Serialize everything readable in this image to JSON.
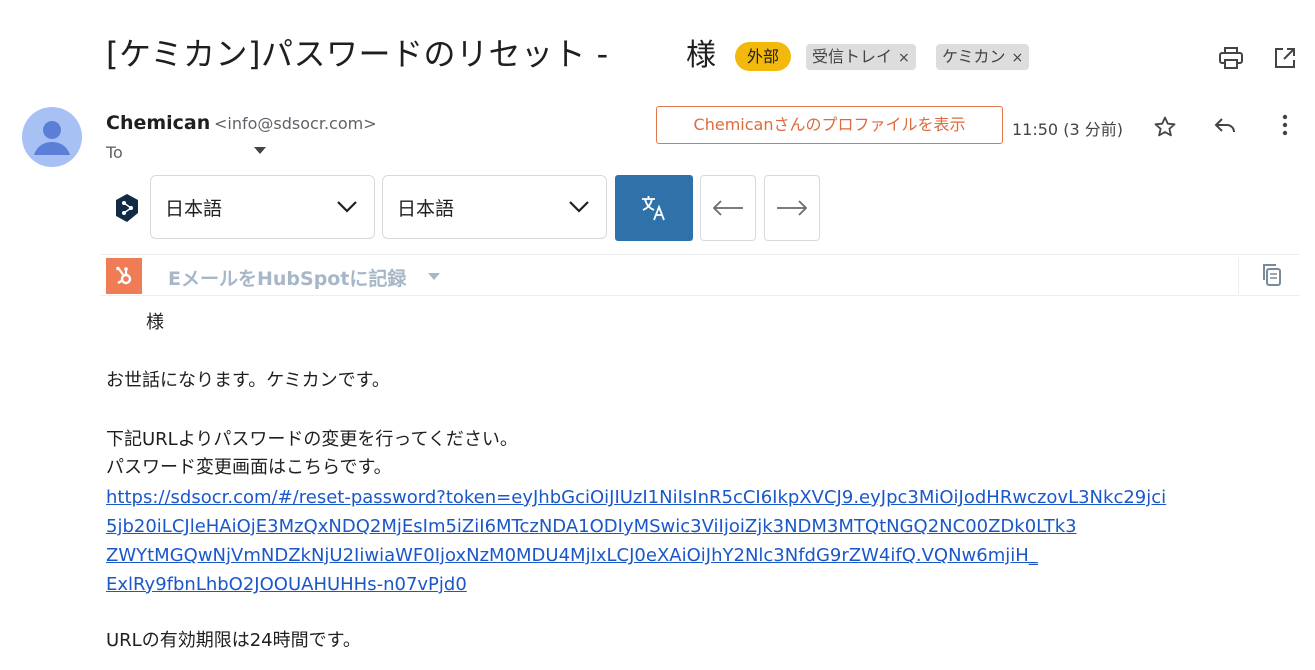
{
  "header": {
    "subject": "[ケミカン]パスワードのリセット -",
    "recipient_suffix": "様",
    "external_badge": "外部",
    "labels": [
      {
        "label": "受信トレイ",
        "close": "×"
      },
      {
        "label": "ケミカン",
        "close": "×"
      }
    ],
    "icons": [
      "print-icon",
      "open-in-new-window-icon"
    ]
  },
  "sender": {
    "name": "Chemican",
    "email": "<info@sdsocr.com>",
    "to_label": "To",
    "profile_button": "Chemicanさんのプロファイルを表示",
    "time": "11:50 (3 分前)"
  },
  "translate": {
    "source_language": "日本語",
    "target_language": "日本語",
    "translate_icon": "translate-icon",
    "back_arrow": "←",
    "forward_arrow": "→"
  },
  "hubspot": {
    "label": "EメールをHubSpotに記録"
  },
  "body": {
    "greeting": "様",
    "intro": "お世話になります。ケミカンです。",
    "instruction": "下記URLよりパスワードの変更を行ってください。",
    "page_note": "パスワード変更画面はこちらです。",
    "link_lines": [
      "https://sdsocr.com/#/reset-password?token=eyJhbGciOiJIUzI1NiIsInR5cCI6IkpXVCJ9.eyJpc3MiOiJodHRwczovL3Nkc29jci",
      "5jb20iLCJleHAiOjE3MzQxNDQ2MjEsIm5iZiI6MTczNDA1ODIyMSwic3ViIjoiZjk3NDM3MTQtNGQ2NC00ZDk0LTk3",
      "ZWYtMGQwNjVmNDZkNjU2IiwiaWF0IjoxNzM0MDU4MjIxLCJ0eXAiOiJhY2Nlc3NfdG9rZW4ifQ.VQNw6mjiH_",
      "ExlRy9fbnLhbO2JOOUAHUHHs-n07vPjd0"
    ],
    "expiry": "URLの有効期限は24時間です。"
  },
  "colors": {
    "external_badge": "#f2b90c",
    "translate_button": "#2f72a9",
    "hubspot_orange": "#f07c56",
    "link": "#1a57c9",
    "profile_button": "#e06a3c"
  }
}
